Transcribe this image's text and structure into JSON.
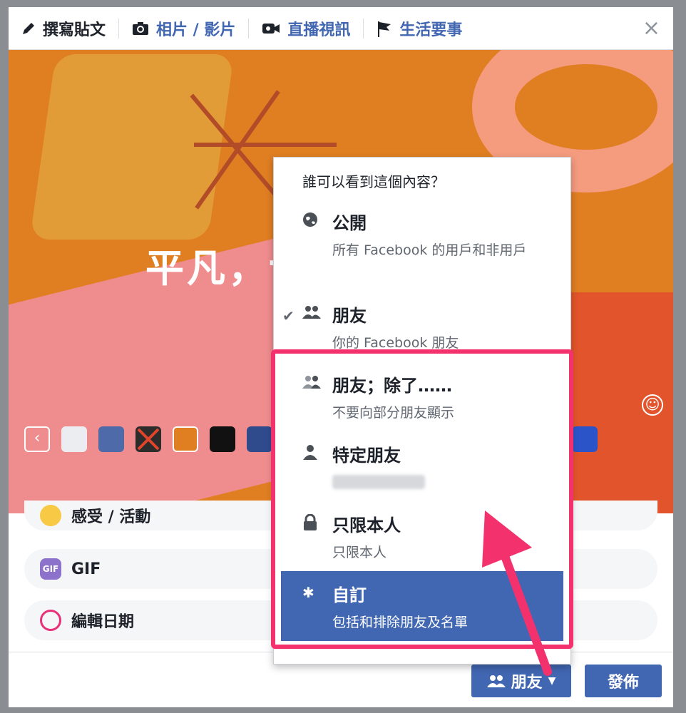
{
  "tabs": [
    {
      "label": "撰寫貼文",
      "icon": "pencil-icon"
    },
    {
      "label": "相片 / 影片",
      "icon": "camera-icon"
    },
    {
      "label": "直播視訊",
      "icon": "video-camera-icon"
    },
    {
      "label": "生活要事",
      "icon": "flag-icon"
    }
  ],
  "close_label": "×",
  "art": {
    "text": "平凡，t"
  },
  "options": [
    {
      "label": "感受 / 活動",
      "icon": "emoji-icon"
    },
    {
      "label": "GIF",
      "icon_text": "GIF"
    },
    {
      "label": "編輯日期",
      "icon": "calendar-edit-icon"
    }
  ],
  "audience": {
    "title": "誰可以看到這個內容？",
    "items": [
      {
        "title": "公開",
        "subtitle": "所有 Facebook 的用戶和非用戶",
        "icon": "globe-icon",
        "selected": false,
        "checked": false
      },
      {
        "title": "朋友",
        "subtitle": "你的 Facebook 朋友",
        "icon": "friends-icon",
        "selected": false,
        "checked": true
      },
      {
        "title": "朋友；除了……",
        "subtitle": "不要向部分朋友顯示",
        "icon": "friends-except-icon",
        "selected": false,
        "checked": false
      },
      {
        "title": "特定朋友",
        "subtitle": "",
        "icon": "person-icon",
        "selected": false,
        "checked": false
      },
      {
        "title": "只限本人",
        "subtitle": "只限本人",
        "icon": "lock-icon",
        "selected": false,
        "checked": false
      },
      {
        "title": "自訂",
        "subtitle": "包括和排除朋友及名單",
        "icon": "gear-icon",
        "selected": true,
        "checked": false
      }
    ]
  },
  "footer": {
    "privacy_button": "朋友",
    "post_button": "發佈"
  },
  "colors": {
    "brand": "#4267b2",
    "highlight": "#f2316d",
    "art_bg": "#e07e22"
  }
}
